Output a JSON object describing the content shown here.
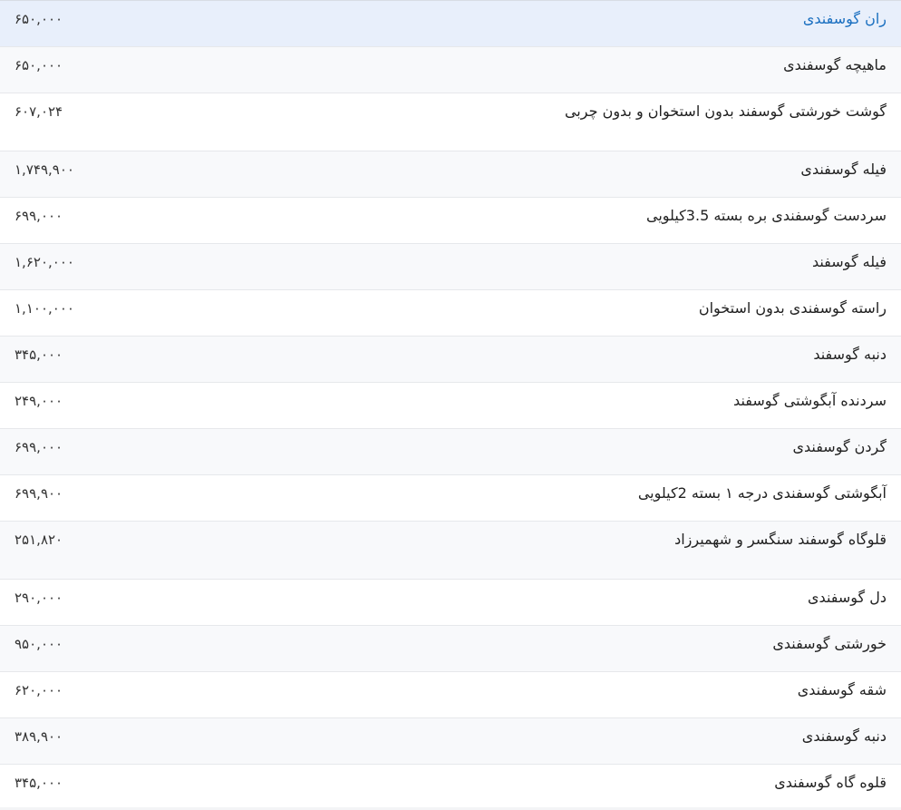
{
  "items": [
    {
      "name": "ران گوسفندی",
      "price": "۶۵۰,۰۰۰"
    },
    {
      "name": "ماهیچه گوسفندی",
      "price": "۶۵۰,۰۰۰"
    },
    {
      "name": "گوشت خورشتی گوسفند بدون استخوان و بدون چربی",
      "price": "۶۰۷,۰۲۴"
    },
    {
      "name": "فیله گوسفندی",
      "price": "۱,۷۴۹,۹۰۰"
    },
    {
      "name": "سردست گوسفندی بره بسته 3.5کیلویی",
      "price": "۶۹۹,۰۰۰"
    },
    {
      "name": "فیله گوسفند",
      "price": "۱,۶۲۰,۰۰۰"
    },
    {
      "name": "راسته گوسفندی بدون استخوان",
      "price": "۱,۱۰۰,۰۰۰"
    },
    {
      "name": "دنبه گوسفند",
      "price": "۳۴۵,۰۰۰"
    },
    {
      "name": "سردنده آبگوشتی گوسفند",
      "price": "۲۴۹,۰۰۰"
    },
    {
      "name": "گردن گوسفندی",
      "price": "۶۹۹,۰۰۰"
    },
    {
      "name": "آبگوشتی گوسفندی درجه ۱ بسته 2کیلویی",
      "price": "۶۹۹,۹۰۰"
    },
    {
      "name": "قلوگاه گوسفند سنگسر و شهمیرزاد",
      "price": "۲۵۱,۸۲۰"
    },
    {
      "name": "دل گوسفندی",
      "price": "۲۹۰,۰۰۰"
    },
    {
      "name": "خورشتی گوسفندی",
      "price": "۹۵۰,۰۰۰"
    },
    {
      "name": "شقه گوسفندی",
      "price": "۶۲۰,۰۰۰"
    },
    {
      "name": "دنبه گوسفندی",
      "price": "۳۸۹,۹۰۰"
    },
    {
      "name": "قلوه گاه گوسفندی",
      "price": "۳۴۵,۰۰۰"
    }
  ]
}
